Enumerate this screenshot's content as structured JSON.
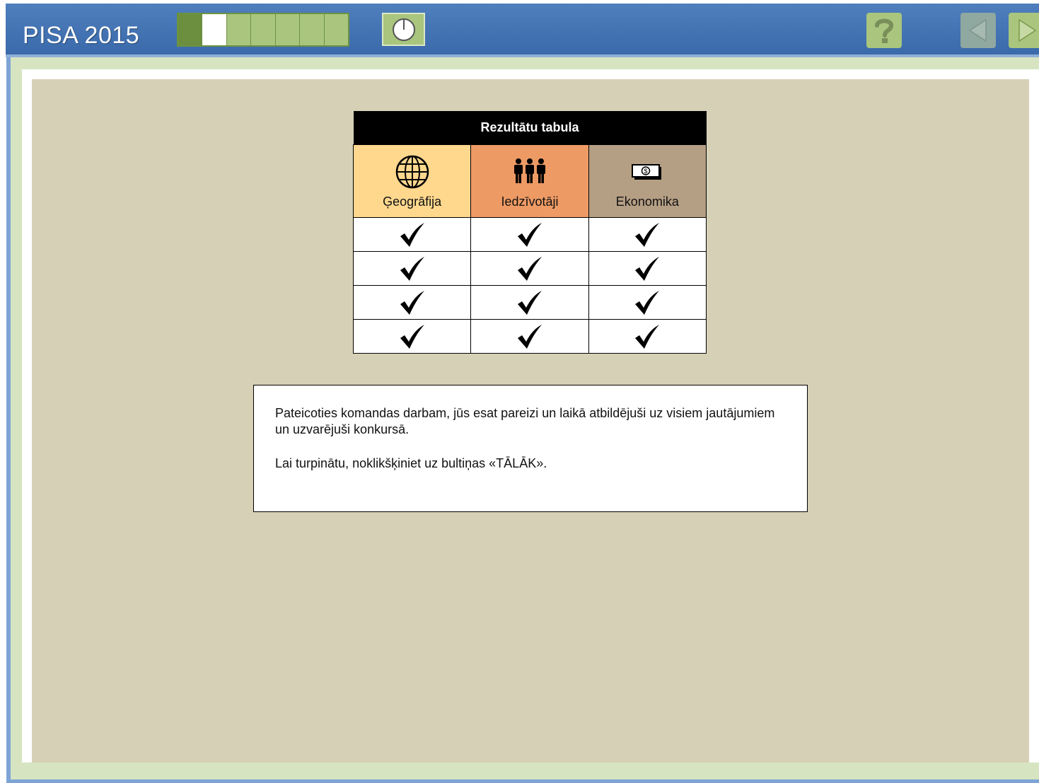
{
  "header": {
    "title": "PISA 2015",
    "progress": {
      "total_units": 7,
      "completed_units": 1,
      "current_unit": 2
    },
    "buttons": {
      "timer": "timer-icon",
      "help": "help-icon",
      "back": "back-arrow-icon",
      "next": "next-arrow-icon"
    }
  },
  "colors": {
    "header": "#4f7fbd",
    "geography": "#ffd88e",
    "population": "#ee9a64",
    "economy": "#b59f84",
    "content_bg": "#d6d0b6"
  },
  "results_table": {
    "caption": "Rezultātu tabula",
    "columns": [
      {
        "label": "Ģeogrāfija",
        "icon": "globe-icon"
      },
      {
        "label": "Iedzīvotāji",
        "icon": "people-icon"
      },
      {
        "label": "Ekonomika",
        "icon": "money-icon"
      }
    ],
    "rows": [
      [
        "✔",
        "✔",
        "✔"
      ],
      [
        "✔",
        "✔",
        "✔"
      ],
      [
        "✔",
        "✔",
        "✔"
      ],
      [
        "✔",
        "✔",
        "✔"
      ]
    ]
  },
  "message": {
    "paragraph1": "Pateicoties komandas darbam, jūs esat pareizi un laikā atbildējuši uz visiem jautājumiem un uzvarējuši konkursā.",
    "paragraph2": "Lai turpinātu, noklikšķiniet uz bultiņas «TĀLĀK»."
  }
}
